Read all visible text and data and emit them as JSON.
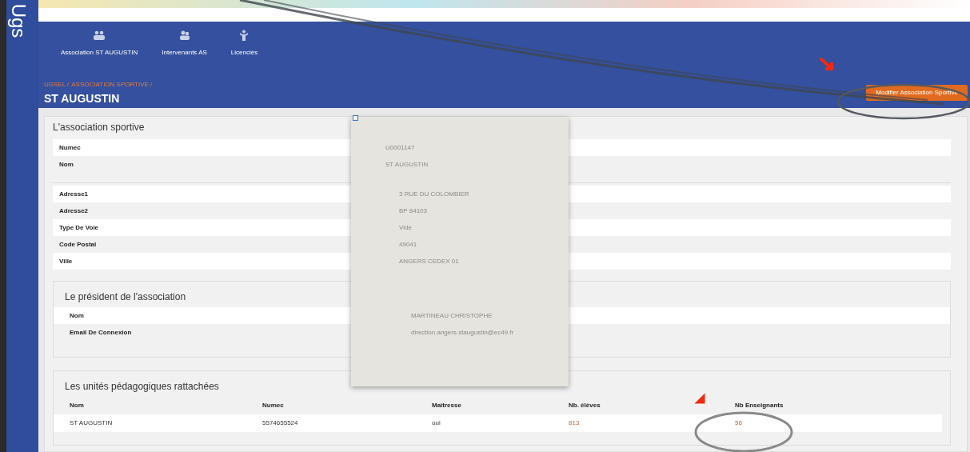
{
  "sidebar": {
    "brand": "Ugs"
  },
  "nav": [
    {
      "label": "Association ST AUGUSTIN",
      "kind": "group"
    },
    {
      "label": "Intervenants AS",
      "kind": "pair"
    },
    {
      "label": "Licenciés",
      "kind": "person"
    }
  ],
  "breadcrumb": [
    "UGSEL /",
    "ASSOCIATION SPORTIVE /"
  ],
  "page_title": "ST AUGUSTIN",
  "edit_button": "Modifier Association Sportive",
  "association": {
    "title": "L'association sportive",
    "groups": [
      [
        {
          "label": "Numec",
          "value": "U0001147"
        },
        {
          "label": "Nom",
          "value": "ST AUGUSTIN"
        }
      ],
      [
        {
          "label": "Adresse1",
          "value": "3 RUE DU COLOMBIER"
        },
        {
          "label": "Adresse2",
          "value": "BP 84103"
        },
        {
          "label": "Type De Voie",
          "value": "Vide"
        },
        {
          "label": "Code Postal",
          "value": "49041"
        },
        {
          "label": "Ville",
          "value": "ANGERS CEDEX 01"
        }
      ]
    ]
  },
  "president": {
    "title": "Le président de l'association",
    "fields": [
      {
        "label": "Nom",
        "value": "MARTINEAU CHRISTOPHE"
      },
      {
        "label": "Email De Connexion",
        "value": "direction.angers.staugustin@ec49.fr"
      }
    ]
  },
  "units": {
    "title": "Les unités pédagogiques rattachées",
    "columns": [
      "Nom",
      "Numec",
      "Maitresse",
      "Nb. élèves",
      "Nb Enseignants"
    ],
    "rows": [
      [
        "ST AUGUSTIN",
        "5574655524",
        "oui",
        "813",
        "56"
      ]
    ]
  }
}
